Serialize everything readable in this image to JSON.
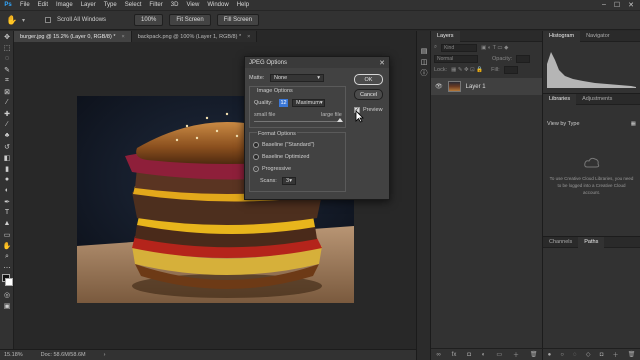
{
  "menubar": {
    "logo": "Ps",
    "items": [
      "File",
      "Edit",
      "Image",
      "Layer",
      "Type",
      "Select",
      "Filter",
      "3D",
      "View",
      "Window",
      "Help"
    ],
    "window_controls": [
      "–",
      "☐",
      "✕"
    ]
  },
  "options_bar": {
    "scroll_all_windows": "Scroll All Windows",
    "zoom_100": "100%",
    "fit_screen": "Fit Screen",
    "fill_screen": "Fill Screen"
  },
  "tabs": [
    {
      "label": "burger.jpg @ 15.2% (Layer 0, RGB/8) *",
      "close": "×"
    },
    {
      "label": "backpack.png @ 100% (Layer 1, RGB/8) *",
      "close": "×"
    }
  ],
  "status": {
    "zoom": "15.18%",
    "doc": "Doc: 58.6M/58.6M",
    "arrow": "›"
  },
  "layers_panel": {
    "tab": "Layers",
    "kind_placeholder": "Kind",
    "blend_mode": "Normal",
    "opacity_label": "Opacity:",
    "lock_label": "Lock:",
    "fill_label": "Fill:",
    "layer_name": "Layer 1",
    "footer_icons": [
      "link-icon",
      "fx-icon",
      "mask-icon",
      "adjustment-icon",
      "group-icon",
      "new-layer-icon",
      "trash-icon"
    ]
  },
  "histogram_panel": {
    "tabs": [
      "Histogram",
      "Navigator"
    ]
  },
  "libraries_panel": {
    "tabs": [
      "Libraries",
      "Adjustments"
    ],
    "view_by": "View by Type",
    "message": "To use Creative Cloud Libraries, you need to be logged into a Creative Cloud account."
  },
  "paths_panel": {
    "tabs": [
      "Channels",
      "Paths"
    ]
  },
  "dialog": {
    "title": "JPEG Options",
    "close": "✕",
    "matte_label": "Matte:",
    "matte_value": "None",
    "image_options_label": "Image Options",
    "quality_label": "Quality:",
    "quality_value": "12",
    "quality_preset": "Maximum",
    "small_file": "small file",
    "large_file": "large file",
    "quality_fraction": 1.0,
    "format_options_label": "Format Options",
    "format_options": [
      "Baseline (\"Standard\")",
      "Baseline Optimized",
      "Progressive"
    ],
    "selected_format_index": 2,
    "scans_label": "Scans:",
    "scans_value": "3",
    "ok_label": "OK",
    "cancel_label": "Cancel",
    "preview_label": "Preview",
    "preview_checked": true
  },
  "colors": {
    "accent": "#31a8ff",
    "quality_highlight": "#3b78d8"
  }
}
